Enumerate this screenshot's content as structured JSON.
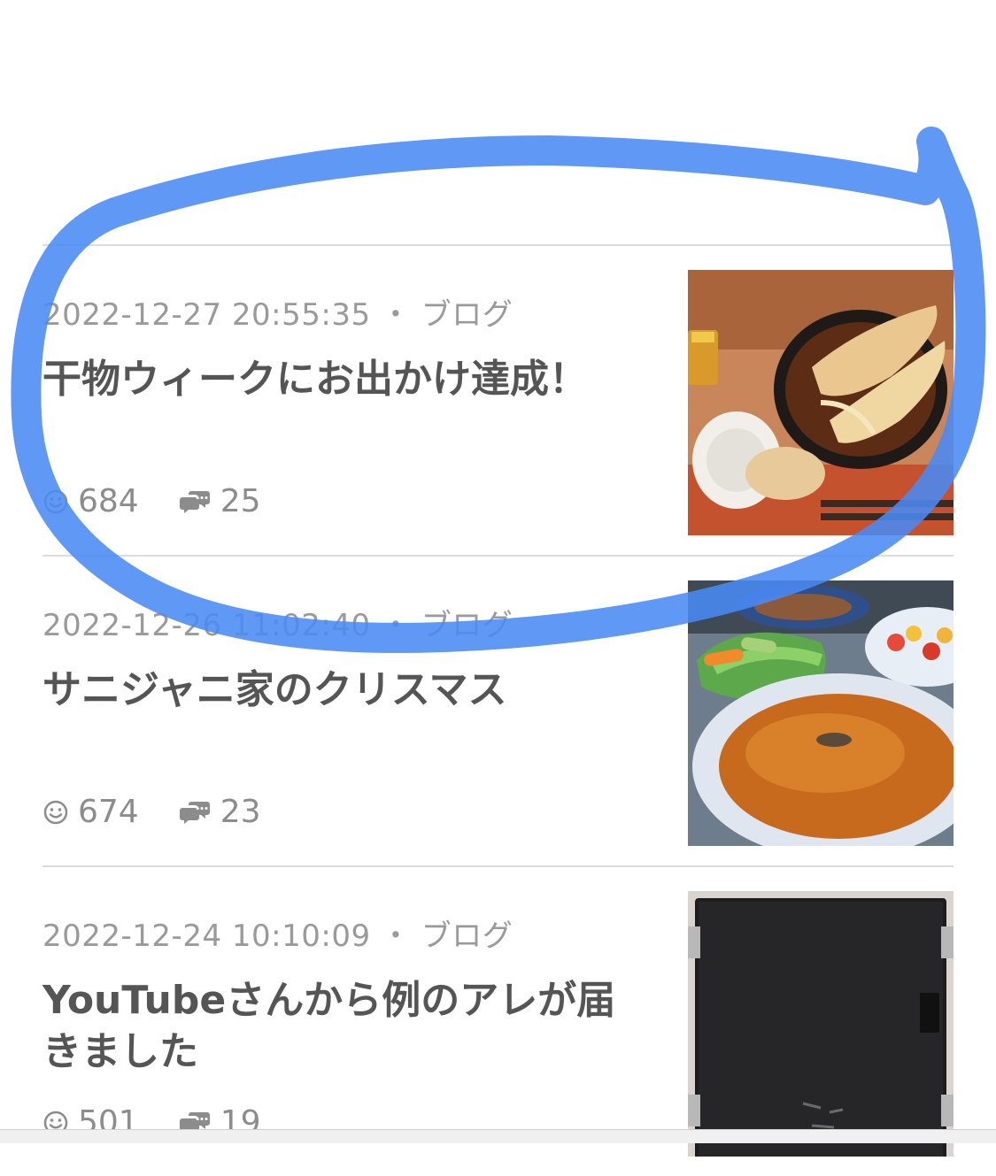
{
  "articles": [
    {
      "date": "2022-12-27 20:55:35",
      "category": "ブログ",
      "title": "干物ウィークにお出かけ達成！",
      "likes": "684",
      "comments": "25",
      "thumbnail": "tempura-soba-image"
    },
    {
      "date": "2022-12-26 11:02:40",
      "category": "ブログ",
      "title": "サニジャニ家のクリスマス",
      "likes": "674",
      "comments": "23",
      "thumbnail": "curry-salad-image"
    },
    {
      "date": "2022-12-24 10:10:09",
      "category": "ブログ",
      "title": "YouTubeさんから例のアレが届きました",
      "likes": "501",
      "comments": "19",
      "thumbnail": "black-board-image"
    }
  ],
  "separator": "・",
  "colors": {
    "annotation_circle": "#4a8af4",
    "divider": "#dcdcdc",
    "meta_text": "#9a9a9a",
    "title_text": "#555555"
  },
  "icons": {
    "likes": "smiley-icon",
    "comments": "speech-bubbles-icon"
  }
}
